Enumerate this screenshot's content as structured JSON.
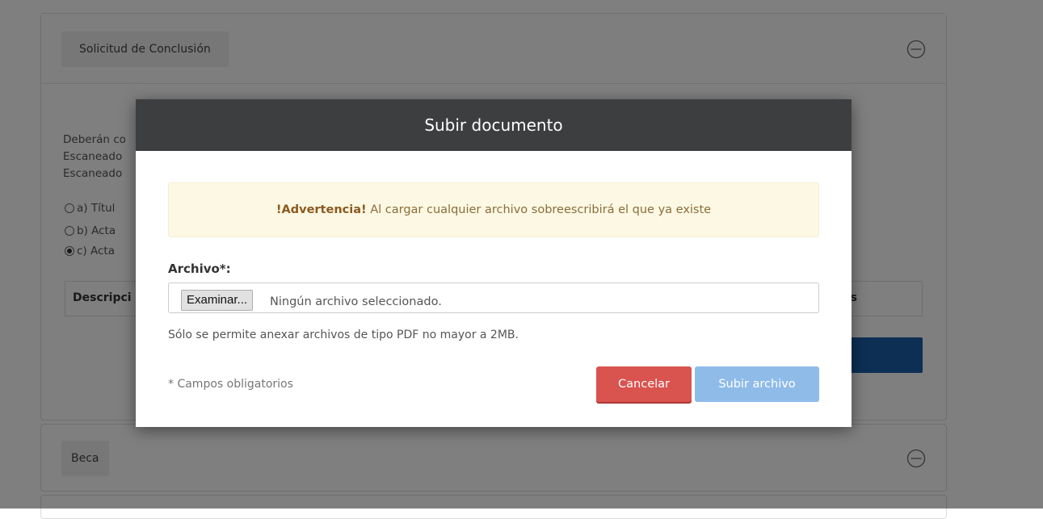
{
  "background": {
    "panel_conclusion": {
      "title": "Solicitud de Conclusión",
      "body_lines": [
        "Deberán co",
        "Escaneado",
        "Escaneado"
      ],
      "options": [
        {
          "label": "a) Títul",
          "checked": false
        },
        {
          "label": "b) Acta",
          "checked": false
        },
        {
          "label": "c) Acta",
          "checked": true
        }
      ],
      "table_header_left": "Descripci",
      "table_header_right": "s"
    },
    "panel_beca": {
      "title": "Beca"
    }
  },
  "modal": {
    "title": "Subir documento",
    "alert": {
      "strong": "!Advertencia!",
      "text": " Al cargar cualquier archivo sobreescribirá el que ya existe"
    },
    "file_label": "Archivo*:",
    "browse_label": "Examinar...",
    "file_status": "Ningún archivo seleccionado.",
    "help_text": "Sólo se permite anexar archivos de tipo PDF no mayor a 2MB.",
    "required_note": "* Campos obligatorios",
    "cancel_label": "Cancelar",
    "upload_label": "Subir archivo"
  },
  "colors": {
    "modal_header": "#3c3e3f",
    "alert_bg": "#fcf8e3",
    "cancel": "#d9534f",
    "upload": "#8fbbe9"
  },
  "icons": {
    "collapse": "minus-circle-icon"
  }
}
